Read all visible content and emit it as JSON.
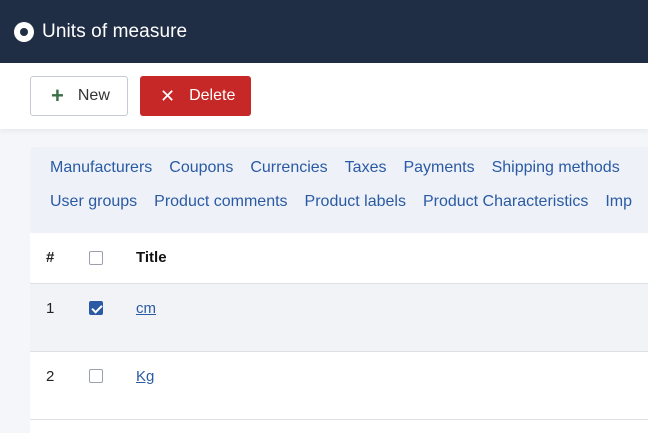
{
  "header": {
    "title": "Units of measure"
  },
  "toolbar": {
    "new_label": "New",
    "delete_label": "Delete",
    "new_icon": "plus-icon",
    "delete_icon": "x-icon"
  },
  "subnav": {
    "row1": [
      "Manufacturers",
      "Coupons",
      "Currencies",
      "Taxes",
      "Payments",
      "Shipping methods"
    ],
    "row2": [
      "User groups",
      "Product comments",
      "Product labels",
      "Product Characteristics",
      "Imp"
    ]
  },
  "table": {
    "headers": {
      "num": "#",
      "title": "Title"
    },
    "rows": [
      {
        "num": "1",
        "title": "cm",
        "checked": true
      },
      {
        "num": "2",
        "title": "Kg",
        "checked": false
      }
    ]
  },
  "colors": {
    "header_bg": "#1f2d45",
    "delete_bg": "#c52827",
    "link": "#2a5aa3"
  }
}
